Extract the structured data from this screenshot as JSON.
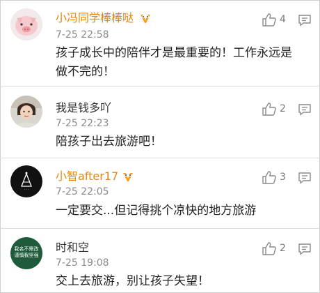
{
  "comments": [
    {
      "username": "小冯同学棒棒哒",
      "time": "7-25 22:58",
      "content": "孩子成长中的陪伴才是最重要的！工作永远是做不完的！",
      "likes": "4",
      "avatar": "pig-avatar",
      "vip": true
    },
    {
      "username": "我是钱多吖",
      "time": "7-25 22:23",
      "content": "陪孩子出去旅游吧！",
      "likes": "2",
      "avatar": "child-photo-avatar",
      "vip": false
    },
    {
      "username": "小智after17",
      "time": "7-25 22:05",
      "content": "一定要交...但记得挑个凉快的地方旅游",
      "likes": "3",
      "avatar": "black-logo-avatar",
      "vip": true
    },
    {
      "username": "时和空",
      "time": "7-25 19:08",
      "content": "交上去旅游，别让孩子失望！",
      "likes": "2",
      "avatar": "green-text-avatar",
      "avatar_text": "我名不需改\n谨慎我坚强",
      "vip": false
    }
  ],
  "colors": {
    "vip_name": "#e8840c",
    "name": "#333333",
    "time": "#8a8a8a",
    "content": "#222222"
  }
}
